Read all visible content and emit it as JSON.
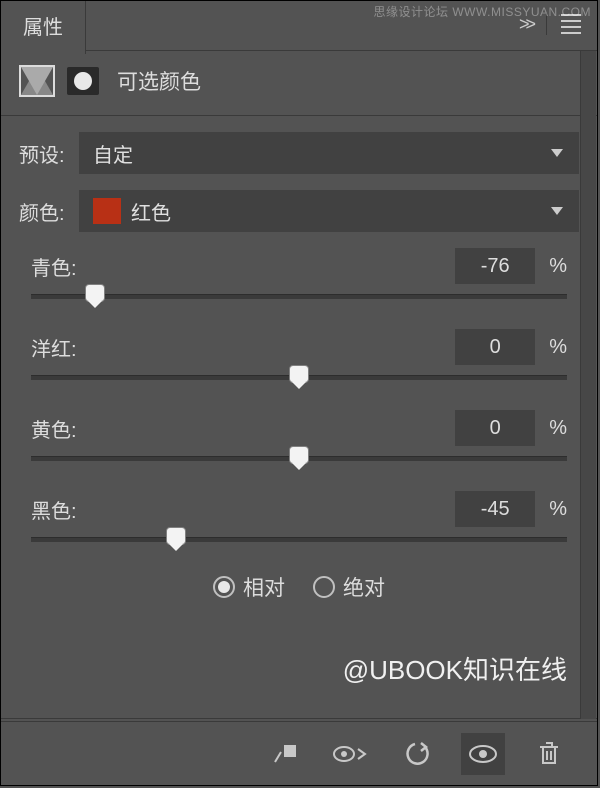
{
  "watermark_top": "思缘设计论坛 WWW.MISSYUAN.COM",
  "header": {
    "tab": "属性"
  },
  "subheader": {
    "label": "可选颜色"
  },
  "preset": {
    "label": "预设:",
    "value": "自定"
  },
  "color": {
    "label": "颜色:",
    "value": "红色",
    "swatch": "#b83015"
  },
  "sliders": {
    "cyan": {
      "label": "青色:",
      "value": "-76",
      "unit": "%",
      "pos": 12
    },
    "magenta": {
      "label": "洋红:",
      "value": "0",
      "unit": "%",
      "pos": 50
    },
    "yellow": {
      "label": "黄色:",
      "value": "0",
      "unit": "%",
      "pos": 50
    },
    "black": {
      "label": "黑色:",
      "value": "-45",
      "unit": "%",
      "pos": 27
    }
  },
  "method": {
    "relative": "相对",
    "absolute": "绝对"
  },
  "credit": "@UBOOK知识在线"
}
